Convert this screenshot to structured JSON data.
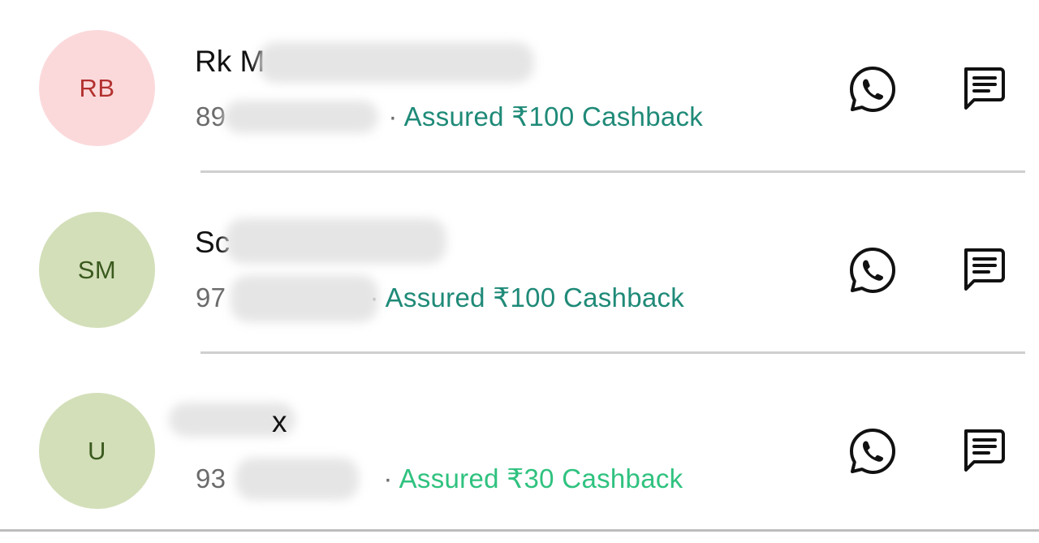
{
  "colors": {
    "avatar_pink_bg": "#fbd9db",
    "avatar_pink_text": "#b3312f",
    "avatar_green_bg": "#d3dfb9",
    "avatar_green_text": "#3a5a1e",
    "cashback_teal": "#1f8a78",
    "cashback_green": "#2fc27f"
  },
  "contacts": [
    {
      "initials": "RB",
      "name": "Rk M",
      "phone": "89",
      "separator": "·",
      "cashback": "Assured ₹100 Cashback",
      "whatsapp_icon": "whatsapp-icon",
      "message_icon": "message-icon"
    },
    {
      "initials": "SM",
      "name": "Sc",
      "phone": "97",
      "separator": "·",
      "cashback": "Assured ₹100 Cashback",
      "whatsapp_icon": "whatsapp-icon",
      "message_icon": "message-icon"
    },
    {
      "initials": "U",
      "name": "x",
      "phone": "93",
      "separator": "·",
      "cashback": "Assured ₹30 Cashback",
      "whatsapp_icon": "whatsapp-icon",
      "message_icon": "message-icon"
    }
  ]
}
